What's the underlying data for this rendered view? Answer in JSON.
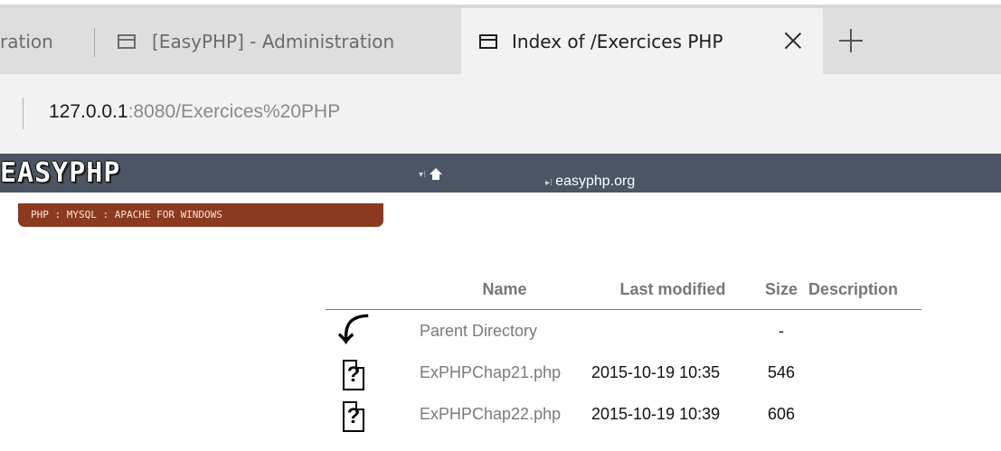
{
  "browser": {
    "tabs": [
      {
        "label": "ration"
      },
      {
        "label": "[EasyPHP] - Administration"
      },
      {
        "label": "Index of /Exercices PHP",
        "active": true
      }
    ],
    "url_host": "127.0.0.1",
    "url_rest": ":8080/Exercices%20PHP"
  },
  "site": {
    "logo": "EASYPHP",
    "tagline": "PHP : MYSQL : APACHE FOR WINDOWS",
    "nav_arrow": "▾⁝",
    "link_arrow": "▸⁝",
    "link": "easyphp.org",
    "nav_color": "#4b5563",
    "tagline_color": "#8c3a1f"
  },
  "listing": {
    "headers": {
      "name": "Name",
      "modified": "Last modified",
      "size": "Size",
      "description": "Description"
    },
    "rows": [
      {
        "icon": "back-icon",
        "name": "Parent Directory",
        "modified": "",
        "size": "-"
      },
      {
        "icon": "unknown-file-icon",
        "name": "ExPHPChap21.php",
        "modified": "2015-10-19 10:35",
        "size": "546"
      },
      {
        "icon": "unknown-file-icon",
        "name": "ExPHPChap22.php",
        "modified": "2015-10-19 10:39",
        "size": "606"
      }
    ]
  }
}
